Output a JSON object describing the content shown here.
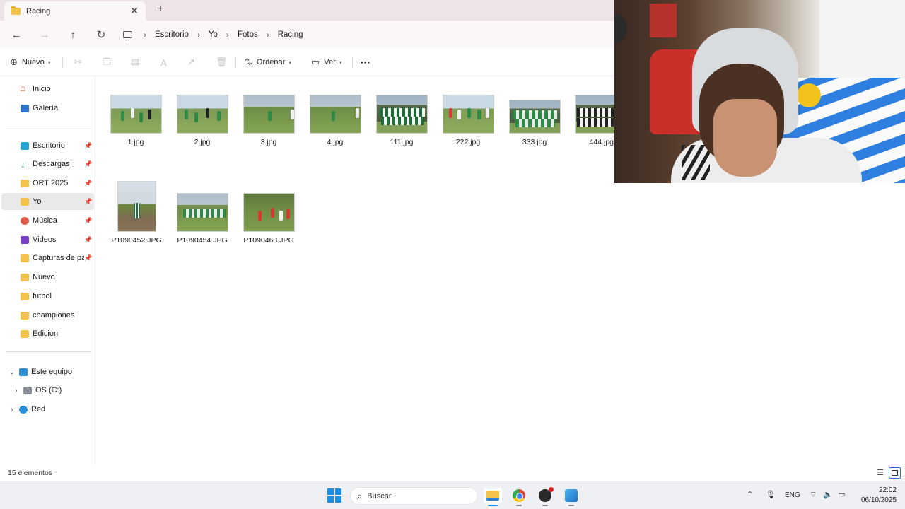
{
  "window": {
    "tab_title": "Racing",
    "new_tab_symbol": "+",
    "close_symbol": "✕"
  },
  "address": {
    "breadcrumbs": [
      "Escritorio",
      "Yo",
      "Fotos",
      "Racing"
    ]
  },
  "toolbar": {
    "new_label": "Nuevo",
    "sort_label": "Ordenar",
    "view_label": "Ver",
    "more_symbol": "···"
  },
  "sidebar": {
    "quick": [
      {
        "label": "Inicio",
        "icon": "home-icon"
      },
      {
        "label": "Galería",
        "icon": "gallery-icon"
      }
    ],
    "pinned": [
      {
        "label": "Escritorio",
        "icon": "desktop-icon",
        "pinned": true
      },
      {
        "label": "Descargas",
        "icon": "download-icon",
        "pinned": true
      },
      {
        "label": "ORT 2025",
        "icon": "folder-icon",
        "pinned": true
      },
      {
        "label": "Yo",
        "icon": "folder-icon",
        "pinned": true,
        "selected": true
      },
      {
        "label": "Música",
        "icon": "music-icon",
        "pinned": true
      },
      {
        "label": "Videos",
        "icon": "video-icon",
        "pinned": true
      },
      {
        "label": "Capturas de pant",
        "icon": "folder-icon",
        "pinned": true
      },
      {
        "label": "Nuevo",
        "icon": "folder-icon",
        "pinned": false
      },
      {
        "label": "futbol",
        "icon": "folder-icon",
        "pinned": false
      },
      {
        "label": "championes",
        "icon": "folder-icon",
        "pinned": false
      },
      {
        "label": "Edicion",
        "icon": "folder-icon",
        "pinned": false
      }
    ],
    "devices": [
      {
        "label": "Este equipo",
        "icon": "pc-icon",
        "expanded": true
      },
      {
        "label": "OS (C:)",
        "icon": "drive-icon",
        "expanded": false
      },
      {
        "label": "Red",
        "icon": "network-icon",
        "expanded": false
      }
    ]
  },
  "files": [
    {
      "name": "1.jpg"
    },
    {
      "name": "2.jpg"
    },
    {
      "name": "3.jpg"
    },
    {
      "name": "4.jpg"
    },
    {
      "name": "111.jpg"
    },
    {
      "name": "222.jpg"
    },
    {
      "name": "333.jpg"
    },
    {
      "name": "444.jpg"
    },
    {
      "name": "P1090452.JPG"
    },
    {
      "name": "P1090454.JPG"
    },
    {
      "name": "P1090463.JPG"
    }
  ],
  "status": {
    "item_count": "15 elementos"
  },
  "taskbar": {
    "search_placeholder": "Buscar",
    "language": "ENG",
    "time": "22:02",
    "date": "06/10/2025"
  },
  "colors": {
    "accent": "#1e8fe6",
    "folder": "#f3c24a",
    "tab_bar": "#efe3ea"
  }
}
